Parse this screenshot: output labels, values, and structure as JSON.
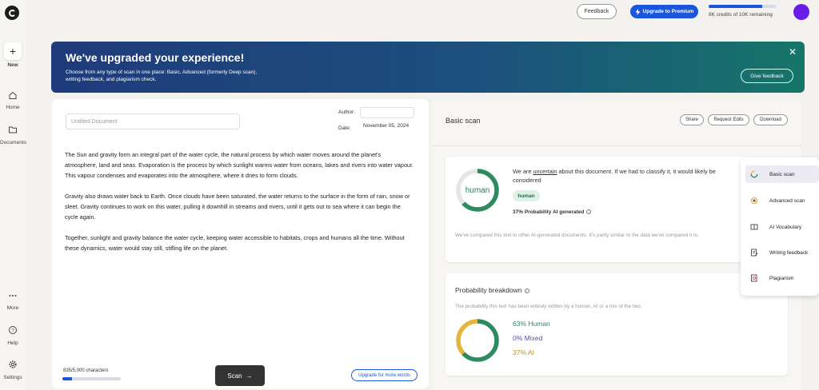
{
  "sidebar": {
    "new_label": "New",
    "items": [
      {
        "label": "Home",
        "icon": "home-icon"
      },
      {
        "label": "Documents",
        "icon": "folder-icon"
      },
      {
        "label": "More",
        "icon": "more-icon"
      },
      {
        "label": "Help",
        "icon": "help-icon"
      },
      {
        "label": "Settings",
        "icon": "gear-icon"
      }
    ]
  },
  "header": {
    "feedback_label": "Feedback",
    "premium_label": "Upgrade to Premium",
    "credits_text": "8K credits of 10K remaining",
    "credits_fraction": 0.8
  },
  "banner": {
    "title": "We've upgraded your experience!",
    "description": "Choose from any type of scan in one place: Basic, Advanced (formerly Deep scan), writing feedback, and plagiarism check.",
    "button_label": "Give feedback",
    "close_glyph": "✕"
  },
  "editor": {
    "title_placeholder": "Untitled Document",
    "author_label": "Author:",
    "date_label": "Date:",
    "date_value": "November 05, 2024",
    "paragraphs": [
      "The Sun and gravity form an integral part of the water cycle, the natural process by which water moves around the planet's atmosphere, land and seas. Evaporation is the process by which sunlight warms water from oceans, lakes and rivers into water vapour. This vapour condenses and evaporates into the atmosphere, where it dries to form clouds.",
      "Gravity also draws water back to Earth. Once clouds have been saturated, the water returns to the surface in the form of rain, snow or sleet. Gravity continues to work on this water, pulling it downhill in streams and rivers, until it gets out to sea where it can begin the cycle again.",
      "Together, sunlight and gravity balance the water cycle, keeping water accessible to habitats, crops and humans all the time. Without these dynamics, water would stay still, stifling life on the planet."
    ],
    "char_count": "835/5,000 characters",
    "char_fraction": 0.167,
    "scan_label": "Scan",
    "scan_arrow": "→",
    "upgrade_words_label": "Upgrade for more words"
  },
  "results": {
    "title": "Basic scan",
    "share_label": "Share",
    "request_edits_label": "Request Edits",
    "download_label": "Download",
    "donut_label": "human",
    "verdict_pre": "We are ",
    "verdict_uncertain": "uncertain",
    "verdict_post": " about this document. If we had to classify it, it would likely be considered",
    "pill": "human",
    "probability_text": "37% Probability AI generated",
    "compare_note": "We've compared this text to other AI-generated documents. It's partly similar to the data we've compared it to.",
    "human_fraction": 0.63,
    "colors": {
      "human": "#2e8b5f",
      "ai": "#e3b73a",
      "mixed": "#5a4ea3",
      "track": "#e5e5e5"
    }
  },
  "breakdown": {
    "title": "Probability breakdown",
    "description": "The probability this text has been entirely written by a human, AI or a mix of the two.",
    "items": [
      {
        "label": "63% Human",
        "value": 63,
        "color": "#2e8b5f"
      },
      {
        "label": "0% Mixed",
        "value": 0,
        "color": "#5a4ea3"
      },
      {
        "label": "37% AI",
        "value": 37,
        "color": "#b8941f"
      }
    ]
  },
  "scan_menu": {
    "items": [
      {
        "label": "Basic scan",
        "icon": "basic-scan-icon",
        "active": true
      },
      {
        "label": "Advanced scan",
        "icon": "advanced-scan-icon",
        "active": false
      },
      {
        "label": "AI Vocabulary",
        "icon": "book-icon",
        "active": false
      },
      {
        "label": "Writing feedback",
        "icon": "pencil-doc-icon",
        "active": false
      },
      {
        "label": "Plagiarism",
        "icon": "plagiarism-icon",
        "active": false
      }
    ]
  }
}
